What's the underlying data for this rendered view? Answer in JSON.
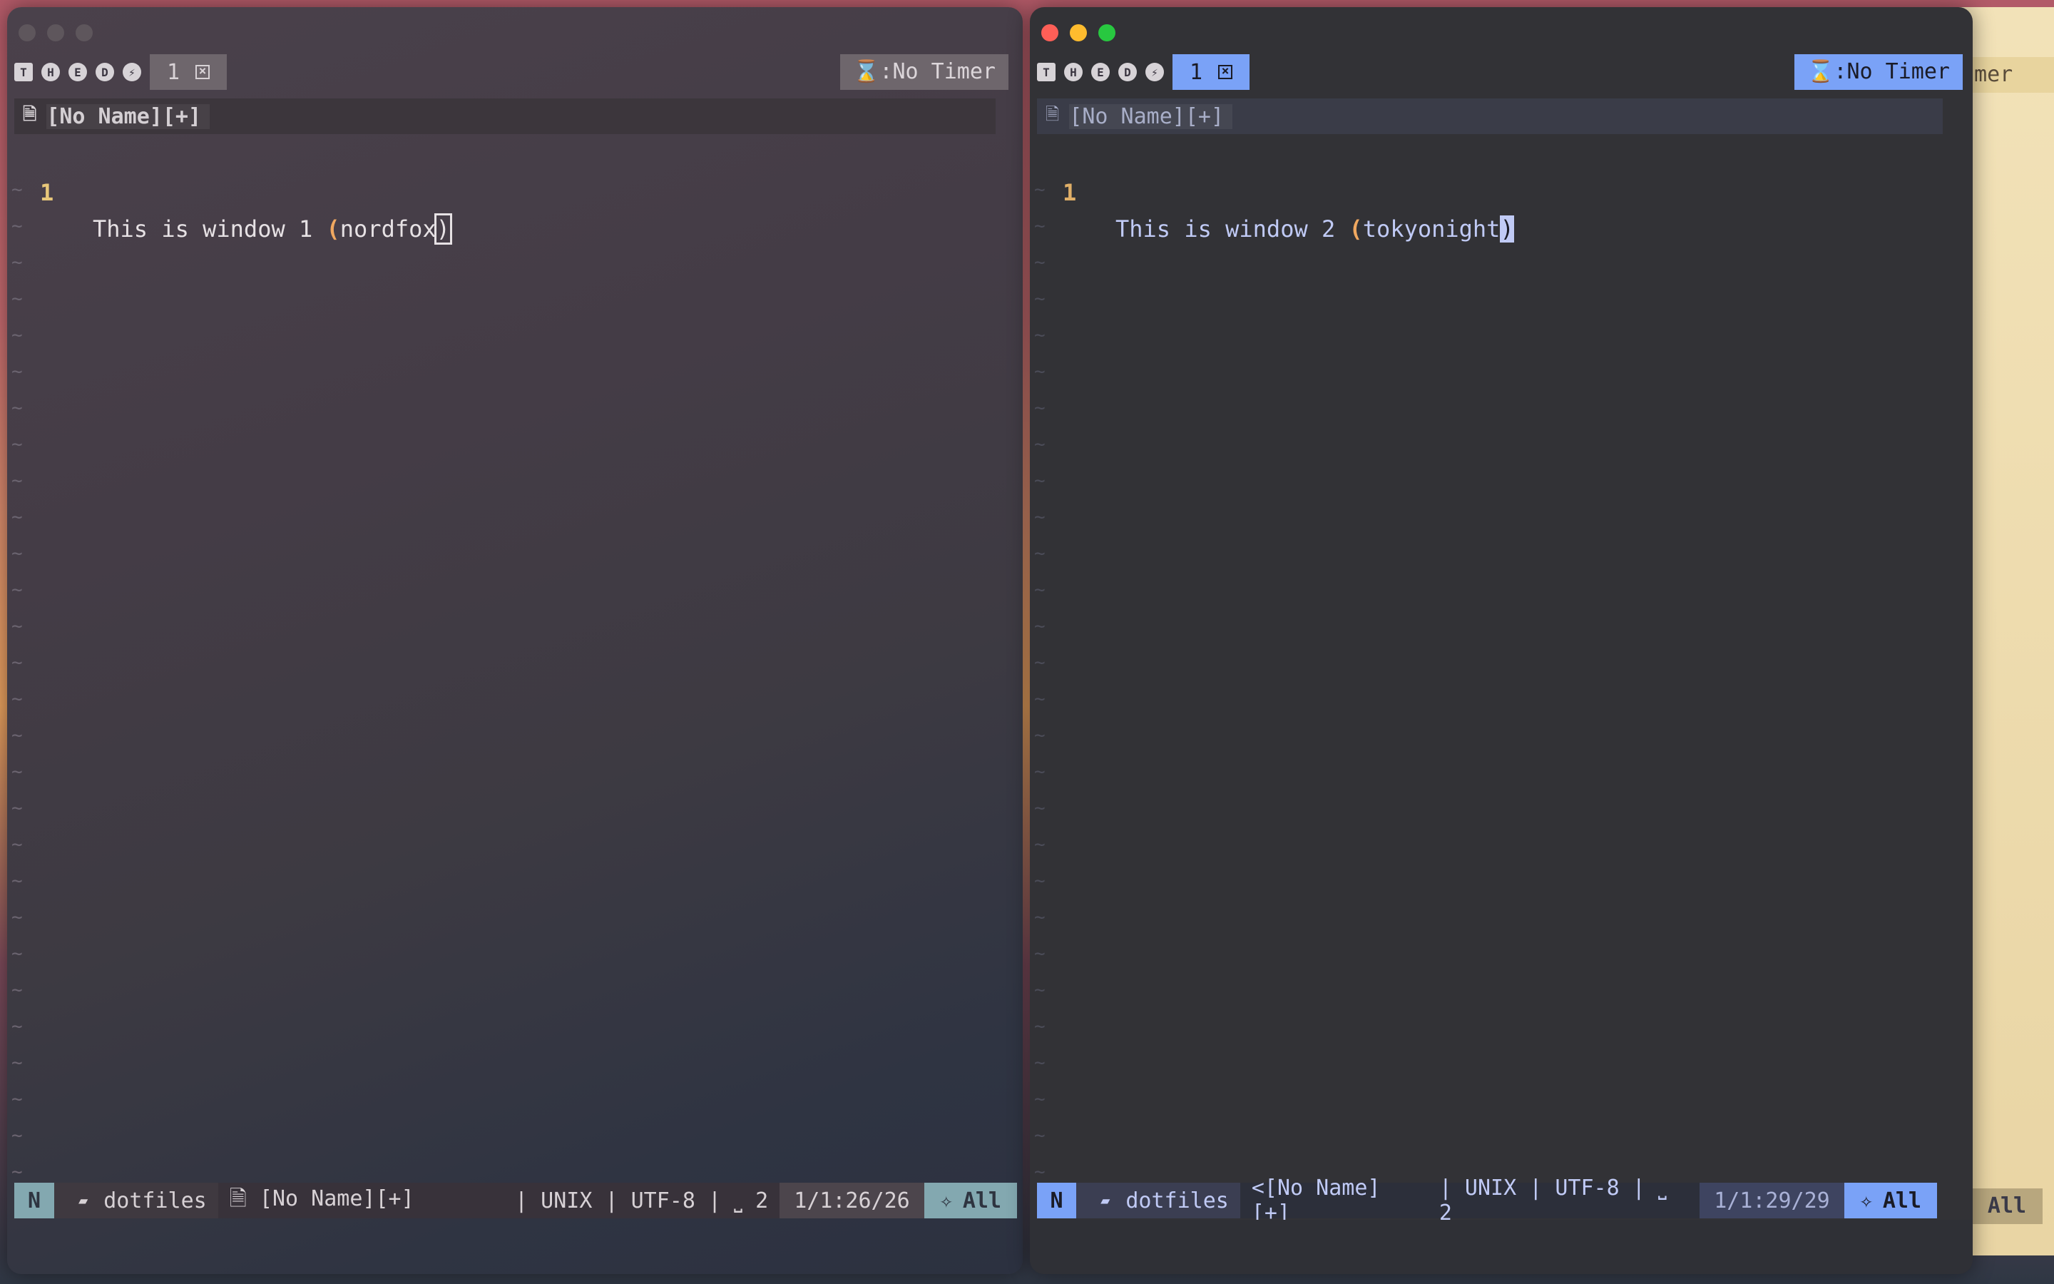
{
  "background": {
    "timer_peek": "imer",
    "all_peek": "All"
  },
  "colors": {
    "nordfox_accent": "#83a8b0",
    "tokyonight_accent": "#7aa2f7",
    "paren": "#f0a860"
  },
  "windows": [
    {
      "tabline": {
        "icons": [
          "T",
          "H",
          "E",
          "D",
          "⚡"
        ],
        "tab_number": "1",
        "close_glyph": "×",
        "timer": "⌛:No Timer"
      },
      "winbar": {
        "file_icon": "🗎",
        "title": "[No Name][+]"
      },
      "buffer": {
        "line_number": "1",
        "text_before": "This is window 1 ",
        "paren_open": "(",
        "word": "nordfox",
        "cursor_char": ")"
      },
      "tilde": "~",
      "statusline": {
        "mode": "N",
        "folder_icon": "▰",
        "dir": "dotfiles",
        "file": "🗎 [No Name][+]",
        "format": "| UNIX | UTF-8 | ⎵ 2",
        "position": "1/1:26/26",
        "all_icon": "✧",
        "scroll": "All"
      }
    },
    {
      "tabline": {
        "icons": [
          "T",
          "H",
          "E",
          "D",
          "⚡"
        ],
        "tab_number": "1",
        "close_glyph": "×",
        "timer": "⌛:No Timer"
      },
      "winbar": {
        "file_icon": "🗎",
        "title": "[No Name][+]"
      },
      "buffer": {
        "line_number": "1",
        "text_before": "This is window 2 ",
        "paren_open": "(",
        "word": "tokyonight",
        "cursor_char": ")"
      },
      "tilde": "~",
      "statusline": {
        "mode": "N",
        "folder_icon": "▰",
        "dir": "dotfiles",
        "file": "<[No Name][+]",
        "format": "| UNIX | UTF-8 | ⎵ 2",
        "position": "1/1:29/29",
        "all_icon": "✧",
        "scroll": "All"
      }
    }
  ]
}
